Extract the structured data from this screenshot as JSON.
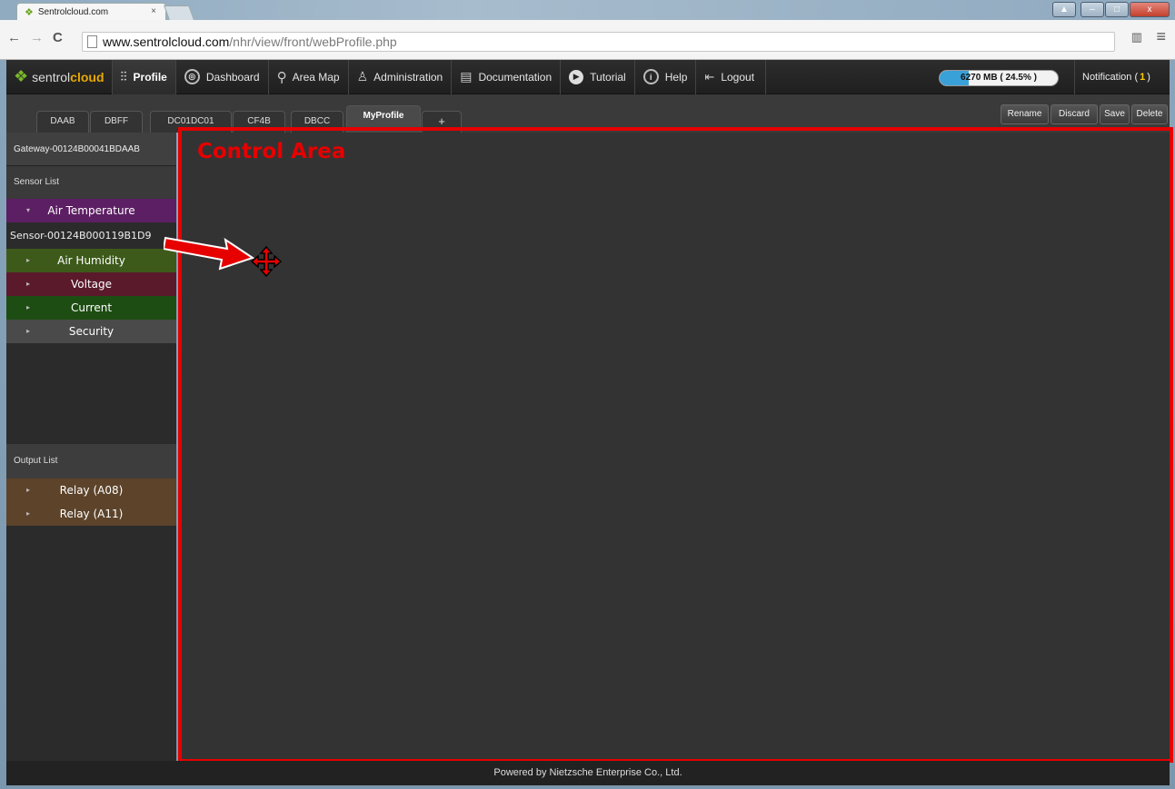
{
  "browser": {
    "tab_title": "Sentrolcloud.com",
    "tab_close": "×",
    "url_host": "www.sentrolcloud.com",
    "url_path": "/nhr/view/front/webProfile.php",
    "back": "←",
    "forward": "→",
    "reload": "C",
    "window_min": "–",
    "window_max": "□",
    "window_close": "x",
    "menu_icon": "≡"
  },
  "navbar": {
    "brand_a": "sentrol",
    "brand_b": "cloud",
    "items": [
      {
        "label": "Profile",
        "icon": "sliders-icon"
      },
      {
        "label": "Dashboard",
        "icon": "dashboard-icon"
      },
      {
        "label": "Area Map",
        "icon": "map-pin-icon"
      },
      {
        "label": "Administration",
        "icon": "user-icon"
      },
      {
        "label": "Documentation",
        "icon": "document-icon"
      },
      {
        "label": "Tutorial",
        "icon": "play-icon"
      },
      {
        "label": "Help",
        "icon": "info-icon"
      },
      {
        "label": "Logout",
        "icon": "logout-icon"
      }
    ],
    "storage_text": "6270 MB ( 24.5% )",
    "storage_percent": 24.5,
    "notification_label": "Notification (",
    "notification_count": "1",
    "notification_close": ")"
  },
  "profile_tabs": {
    "tabs": [
      "DAAB",
      "DBFF",
      "DC01DC01",
      "CF4B",
      "DBCC",
      "MyProfile",
      "+"
    ],
    "active": "MyProfile",
    "actions": [
      "Rename",
      "Discard",
      "Save",
      "Delete"
    ]
  },
  "sidebar": {
    "gateway": "Gateway-00124B00041BDAAB",
    "sensor_list_header": "Sensor List",
    "air_temperature": "Air Temperature",
    "sensor_id": "Sensor-00124B000119B1D9",
    "sensors": [
      "Air Humidity",
      "Voltage",
      "Current",
      "Security"
    ],
    "output_list_header": "Output List",
    "outputs": [
      "Relay (A08)",
      "Relay (A11)"
    ]
  },
  "control_area": {
    "label": "Control Area"
  },
  "footer": {
    "text": "Powered by Nietzsche Enterprise Co., Ltd."
  },
  "colors": {
    "annotation": "#e60000",
    "brand_green": "#78b82a",
    "brand_orange": "#e8a800",
    "storage_fill": "#3aa0d8"
  }
}
